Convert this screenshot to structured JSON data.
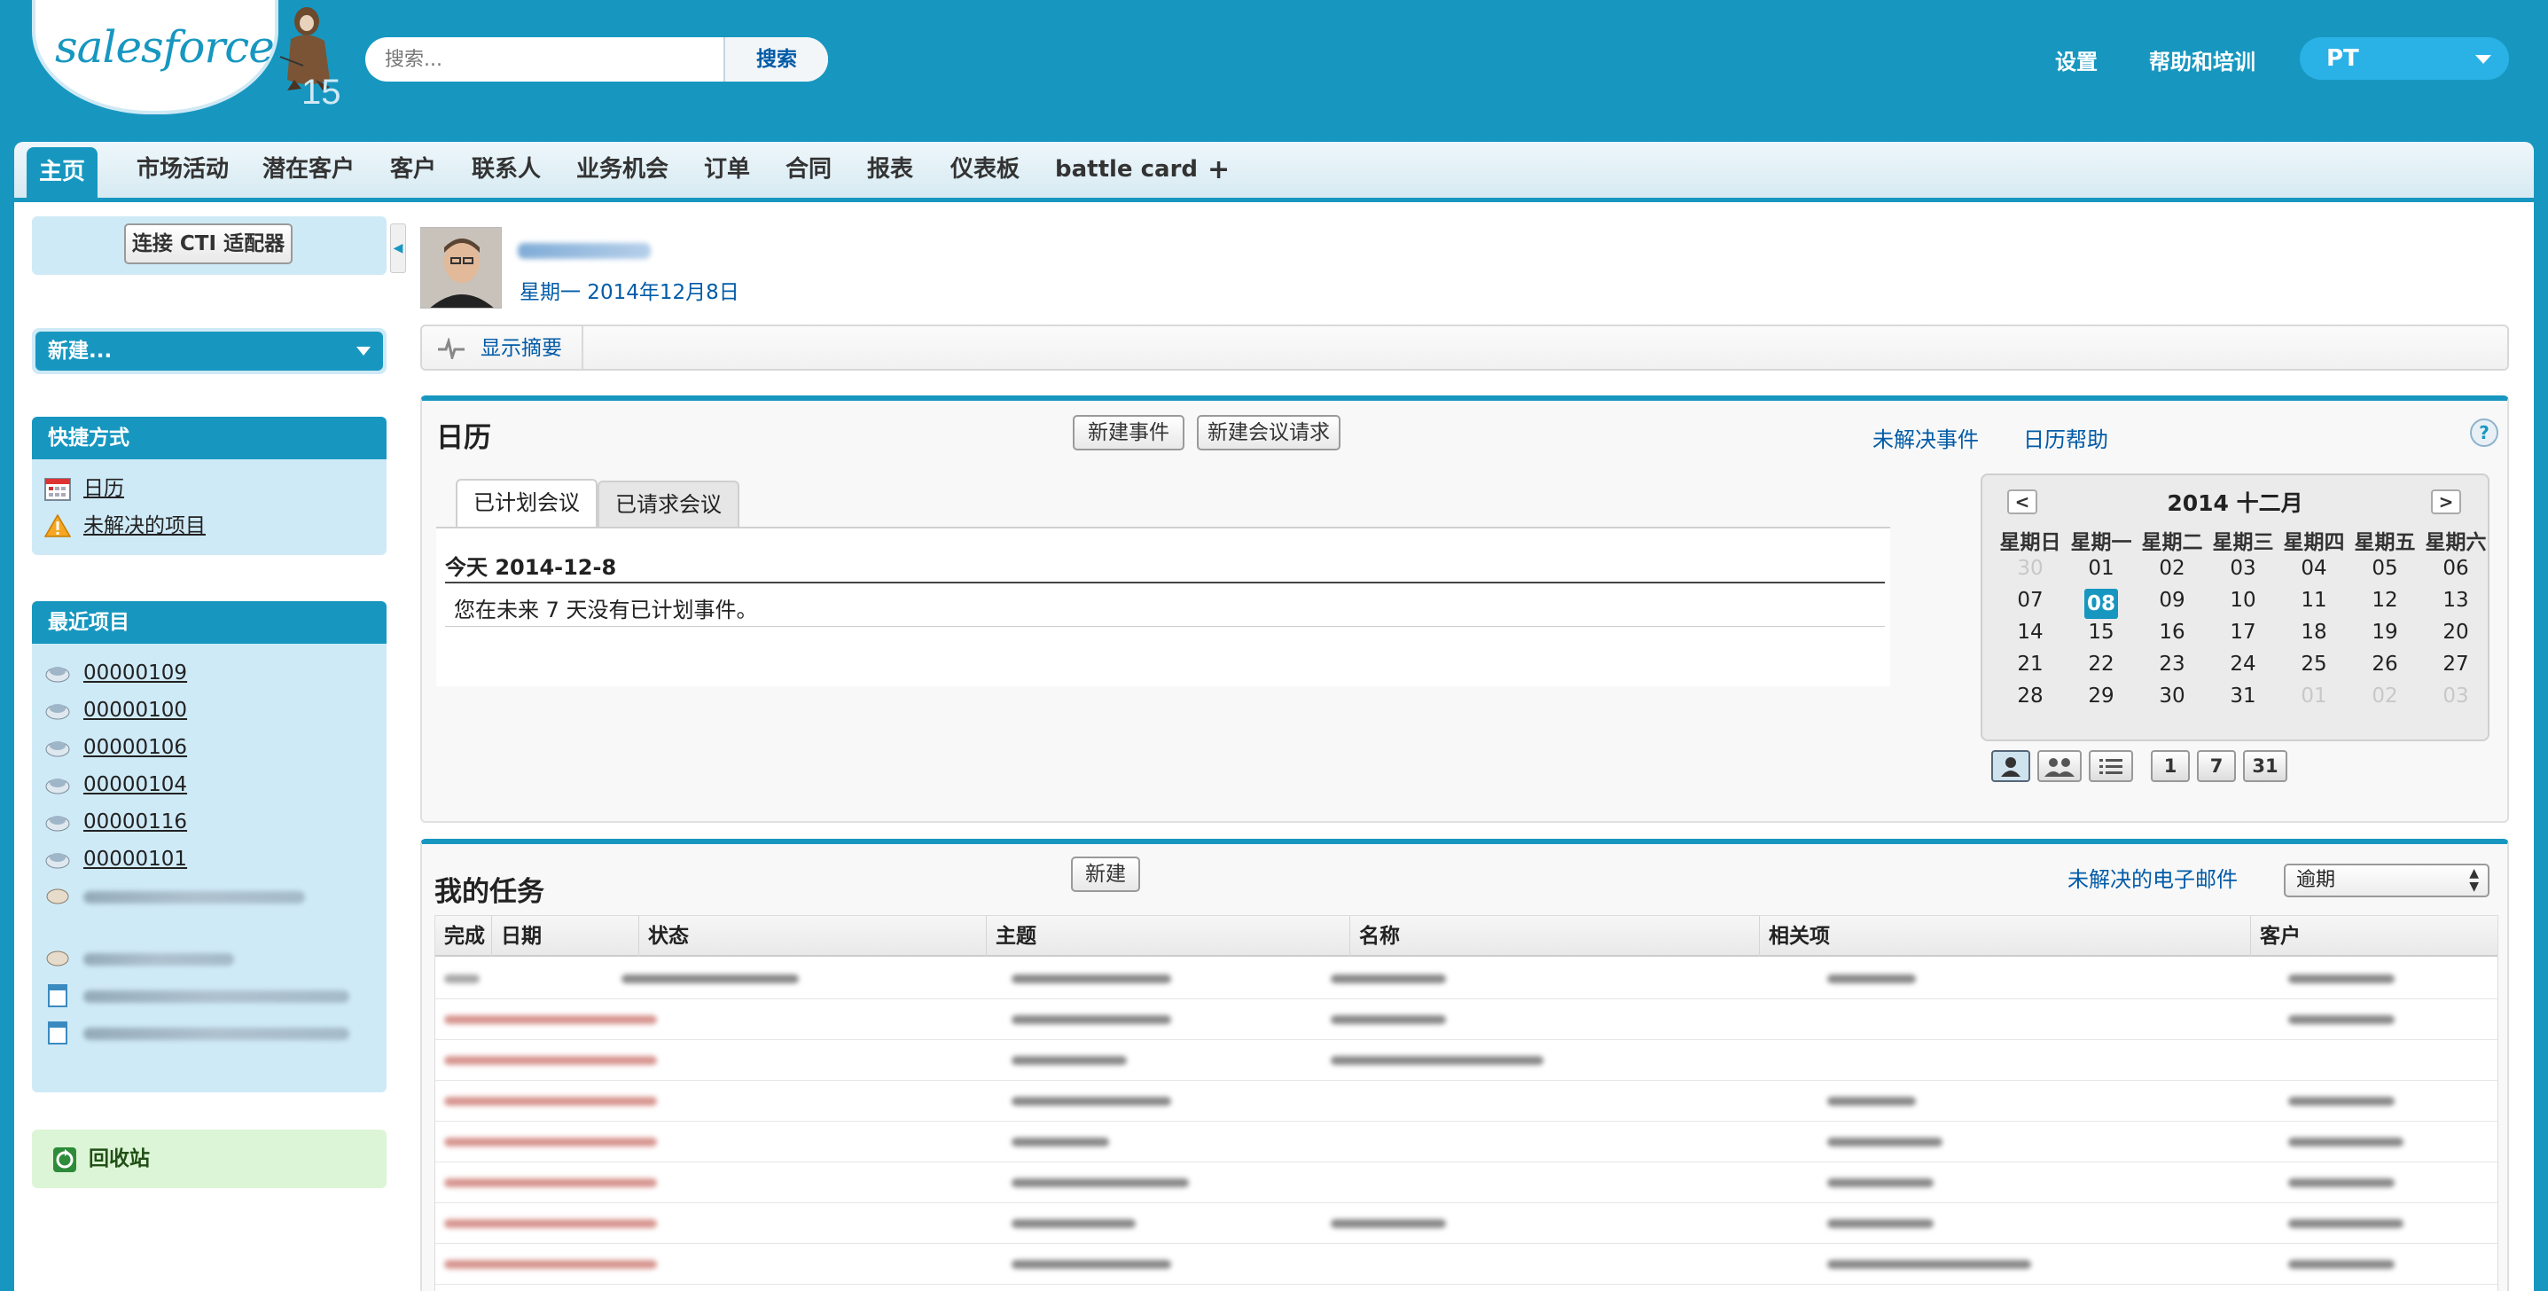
{
  "header": {
    "logo_text": "salesforce",
    "release_badge": "15",
    "search": {
      "placeholder": "搜索...",
      "button_label": "搜索"
    },
    "links": [
      "设置",
      "帮助和培训"
    ],
    "user_initials": "PT"
  },
  "tabs": [
    {
      "label": "主页",
      "active": true
    },
    {
      "label": "市场活动"
    },
    {
      "label": "潜在客户"
    },
    {
      "label": "客户"
    },
    {
      "label": "联系人"
    },
    {
      "label": "业务机会"
    },
    {
      "label": "订单"
    },
    {
      "label": "合同"
    },
    {
      "label": "报表"
    },
    {
      "label": "仪表板"
    },
    {
      "label": "battle card"
    },
    {
      "label": "+"
    }
  ],
  "sidebar": {
    "cti_button": "连接 CTI 适配器",
    "new_dropdown": "新建...",
    "shortcuts": {
      "title": "快捷方式",
      "items": [
        {
          "label": "日历",
          "icon": "calendar-icon"
        },
        {
          "label": "未解决的项目",
          "icon": "warning-icon"
        }
      ]
    },
    "recent": {
      "title": "最近项目",
      "items": [
        "00000109",
        "00000100",
        "00000106",
        "00000104",
        "00000116",
        "00000101"
      ]
    },
    "recycle_bin": "回收站"
  },
  "main": {
    "profile_date": "星期一 2014年12月8日",
    "summary_link": "显示摘要",
    "calendar": {
      "title": "日历",
      "new_event_button": "新建事件",
      "new_meeting_request_button": "新建会议请求",
      "open_events_link": "未解决事件",
      "help_link": "日历帮助",
      "help_icon": "?",
      "tabs": [
        "已计划会议",
        "已请求会议"
      ],
      "today_label": "今天 2014-12-8",
      "no_events_text": "您在未来 7 天没有已计划事件。",
      "mini_calendar": {
        "month_label": "2014 十二月",
        "prev": "<",
        "next": ">",
        "weekdays": [
          "星期日",
          "星期一",
          "星期二",
          "星期三",
          "星期四",
          "星期五",
          "星期六"
        ],
        "weeks": [
          [
            "30",
            "01",
            "02",
            "03",
            "04",
            "05",
            "06"
          ],
          [
            "07",
            "08",
            "09",
            "10",
            "11",
            "12",
            "13"
          ],
          [
            "14",
            "15",
            "16",
            "17",
            "18",
            "19",
            "20"
          ],
          [
            "21",
            "22",
            "23",
            "24",
            "25",
            "26",
            "27"
          ],
          [
            "28",
            "29",
            "30",
            "31",
            "01",
            "02",
            "03"
          ]
        ],
        "today": "08",
        "view_buttons": [
          "1",
          "7",
          "31"
        ]
      }
    },
    "tasks": {
      "title": "我的任务",
      "new_button": "新建",
      "unread_email_link": "未解决的电子邮件",
      "filter_value": "逾期",
      "columns": [
        "完成",
        "日期",
        "状态",
        "主题",
        "名称",
        "相关项",
        "客户"
      ]
    }
  }
}
